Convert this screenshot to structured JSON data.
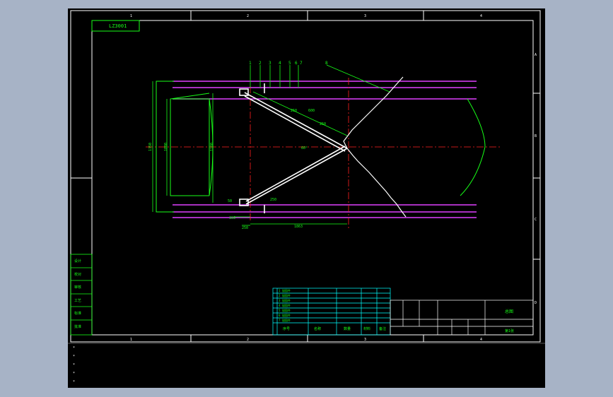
{
  "app": {
    "title": "CAD drawing viewer"
  },
  "palette": {
    "background": "#000000",
    "frame": "#ffffff",
    "dimension": "#17ff17",
    "centerline": "#ff2020",
    "road_edge": "#e040ff",
    "table_lines": "#00ffff"
  },
  "drawing": {
    "drawing_number": "LZ3001",
    "zone_top": [
      "1",
      "2",
      "3",
      "4"
    ],
    "zone_bottom": [
      "1",
      "2",
      "3",
      "4"
    ],
    "zone_right": [
      "A",
      "B",
      "C",
      "D"
    ],
    "callouts": [
      "1",
      "2",
      "3",
      "4",
      "5",
      "6",
      "7",
      "8"
    ],
    "dims": {
      "overall_height": "1350",
      "inner_height": "1000",
      "mid_height": "1100",
      "angle": "60°",
      "upper_a": "250",
      "upper_b": "600",
      "upper_c": "250",
      "lower_a": "250",
      "left_a": "50",
      "left_b": "300",
      "bottom_a": "250",
      "bottom_b": "1863"
    },
    "side_labels": [
      "设计",
      "校对",
      "审核",
      "工艺",
      "标准",
      "批准"
    ],
    "title_block": {
      "name": "总图",
      "sheet": "第1张",
      "row_labels": [
        "序号",
        "名称",
        "数量",
        "材料",
        "备注"
      ],
      "bom_rows": [
        "1  锚固件",
        "2  锚固件",
        "3  锚固件",
        "4  锚固件",
        "5  锚固件",
        "6  锚固件",
        "7  锚固件"
      ]
    },
    "command_lines": [
      "*",
      "*",
      "*",
      "*",
      "*"
    ]
  }
}
